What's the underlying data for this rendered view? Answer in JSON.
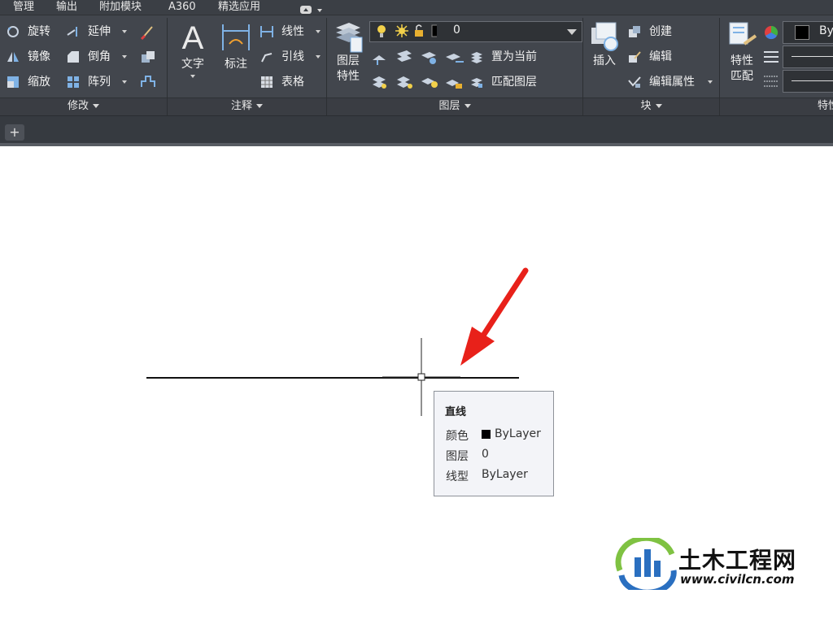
{
  "menu": [
    "管理",
    "输出",
    "附加模块",
    "A360",
    "精选应用"
  ],
  "ribbon": {
    "modify": {
      "title": "修改",
      "tools": [
        "旋转",
        "延伸",
        "镜像",
        "倒角",
        "缩放",
        "阵列"
      ]
    },
    "annotation": {
      "title": "注释",
      "text_button": "文字",
      "dimension_button": "标注",
      "tools": [
        "线性",
        "引线",
        "表格"
      ]
    },
    "layers": {
      "title": "图层",
      "properties_button": [
        "图层",
        "特性"
      ],
      "current_layer": "0",
      "tools": [
        "置为当前",
        "匹配图层"
      ]
    },
    "block": {
      "title": "块",
      "insert_button": "插入",
      "tools": [
        "创建",
        "编辑",
        "编辑属性"
      ]
    },
    "properties": {
      "title": "特性",
      "match_button": [
        "特性",
        "匹配"
      ],
      "color_value": "By"
    }
  },
  "tooltip": {
    "title": "直线",
    "rows": [
      {
        "label": "颜色",
        "value": "ByLayer"
      },
      {
        "label": "图层",
        "value": "0"
      },
      {
        "label": "线型",
        "value": "ByLayer"
      }
    ]
  },
  "watermark": {
    "name": "土木工程网",
    "url": "www.civilcn.com"
  },
  "colors": {
    "ribbon_bg": "#42464d",
    "menubar_bg": "#3b3f45",
    "arrow": "#e8211a",
    "tooltip_bg": "#f3f4f8"
  }
}
